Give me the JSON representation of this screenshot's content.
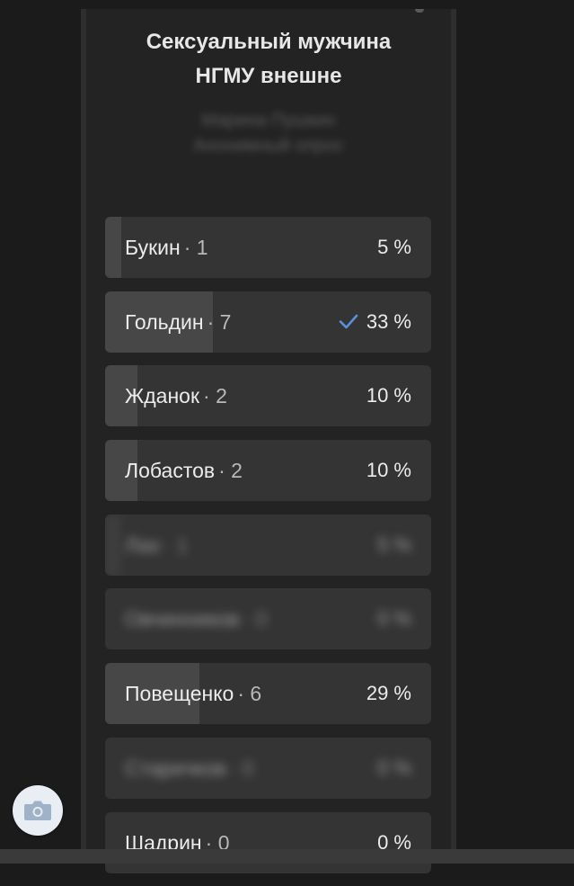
{
  "poll": {
    "title_line1": "Сексуальный мужчина",
    "title_line2": "НГМУ внешне",
    "subtitle_line1": "Марина Пушкин",
    "subtitle_line2": "Анонимный опрос",
    "options": [
      {
        "name": "Букин",
        "count": "1",
        "percent": "5 %",
        "fraction": 0.05,
        "checked": false,
        "blurred": false
      },
      {
        "name": "Гольдин",
        "count": "7",
        "percent": "33 %",
        "fraction": 0.33,
        "checked": true,
        "blurred": false
      },
      {
        "name": "Жданок",
        "count": "2",
        "percent": "10 %",
        "fraction": 0.1,
        "checked": false,
        "blurred": false
      },
      {
        "name": "Лобастов",
        "count": "2",
        "percent": "10 %",
        "fraction": 0.1,
        "checked": false,
        "blurred": false
      },
      {
        "name": "Лах",
        "count": "1",
        "percent": "5 %",
        "fraction": 0.05,
        "checked": false,
        "blurred": true
      },
      {
        "name": "Овчинников",
        "count": "0",
        "percent": "0 %",
        "fraction": 0.0,
        "checked": false,
        "blurred": true
      },
      {
        "name": "Повещенко",
        "count": "6",
        "percent": "29 %",
        "fraction": 0.29,
        "checked": false,
        "blurred": false
      },
      {
        "name": "Старичков",
        "count": "0",
        "percent": "0 %",
        "fraction": 0.0,
        "checked": false,
        "blurred": true
      },
      {
        "name": "Шадрин",
        "count": "0",
        "percent": "0 %",
        "fraction": 0.0,
        "checked": false,
        "blurred": false
      }
    ]
  },
  "colors": {
    "check": "#5b8fd9",
    "fill": "#474747",
    "track": "#343434"
  },
  "icons": {
    "camera": "camera-icon",
    "check": "checkmark-icon"
  }
}
